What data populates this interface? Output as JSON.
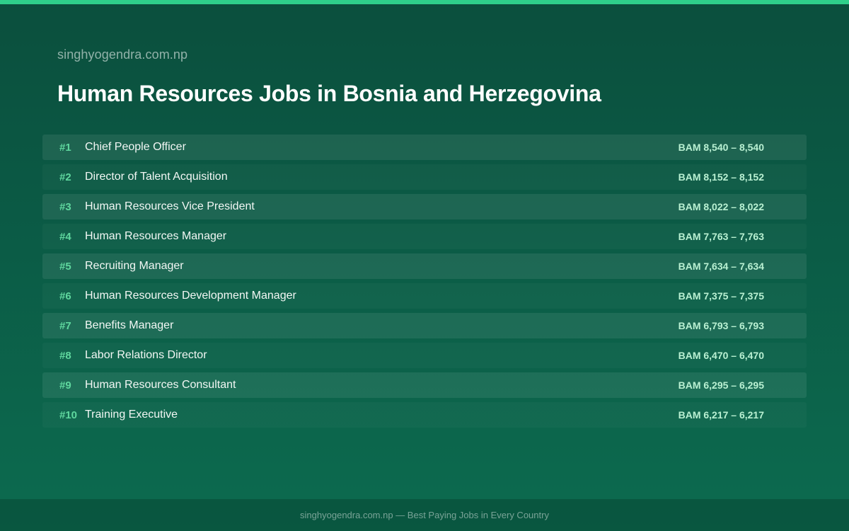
{
  "header": {
    "site_name": "singhyogendra.com.np",
    "title": "Human Resources Jobs in Bosnia and Herzegovina"
  },
  "jobs": [
    {
      "rank": "#1",
      "title": "Chief People Officer",
      "salary": "BAM 8,540 – 8,540"
    },
    {
      "rank": "#2",
      "title": "Director of Talent Acquisition",
      "salary": "BAM 8,152 – 8,152"
    },
    {
      "rank": "#3",
      "title": "Human Resources Vice President",
      "salary": "BAM 8,022 – 8,022"
    },
    {
      "rank": "#4",
      "title": "Human Resources Manager",
      "salary": "BAM 7,763 – 7,763"
    },
    {
      "rank": "#5",
      "title": "Recruiting Manager",
      "salary": "BAM 7,634 – 7,634"
    },
    {
      "rank": "#6",
      "title": "Human Resources Development Manager",
      "salary": "BAM 7,375 – 7,375"
    },
    {
      "rank": "#7",
      "title": "Benefits Manager",
      "salary": "BAM 6,793 – 6,793"
    },
    {
      "rank": "#8",
      "title": "Labor Relations Director",
      "salary": "BAM 6,470 – 6,470"
    },
    {
      "rank": "#9",
      "title": "Human Resources Consultant",
      "salary": "BAM 6,295 – 6,295"
    },
    {
      "rank": "#10",
      "title": "Training Executive",
      "salary": "BAM 6,217 – 6,217"
    }
  ],
  "footer": {
    "text": "singhyogendra.com.np — Best Paying Jobs in Every Country"
  },
  "colors": {
    "accent": "#2fcf8a",
    "rank": "#5fd79e",
    "salary": "#b9f0d2"
  }
}
